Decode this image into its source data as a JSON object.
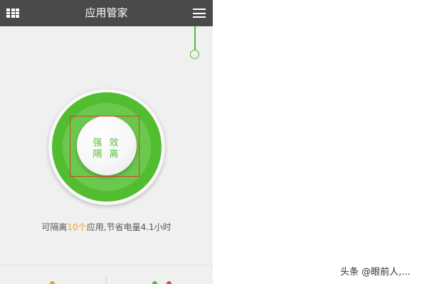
{
  "app": {
    "title": "应用管家"
  },
  "icons": {
    "left": "grid-icon",
    "right": "menu-icon"
  },
  "main_button": {
    "line1": "强 效",
    "line2": "隔 离"
  },
  "status": {
    "prefix": "可隔离",
    "count": "10个",
    "suffix": "应用,节省电量4.1小时"
  },
  "watermark": "头条 @眼前人,...",
  "colors": {
    "titlebar": "#4a4a4a",
    "accent_green": "#53bd32",
    "highlight_orange": "#f0a020",
    "selection_red": "#d0442a"
  }
}
